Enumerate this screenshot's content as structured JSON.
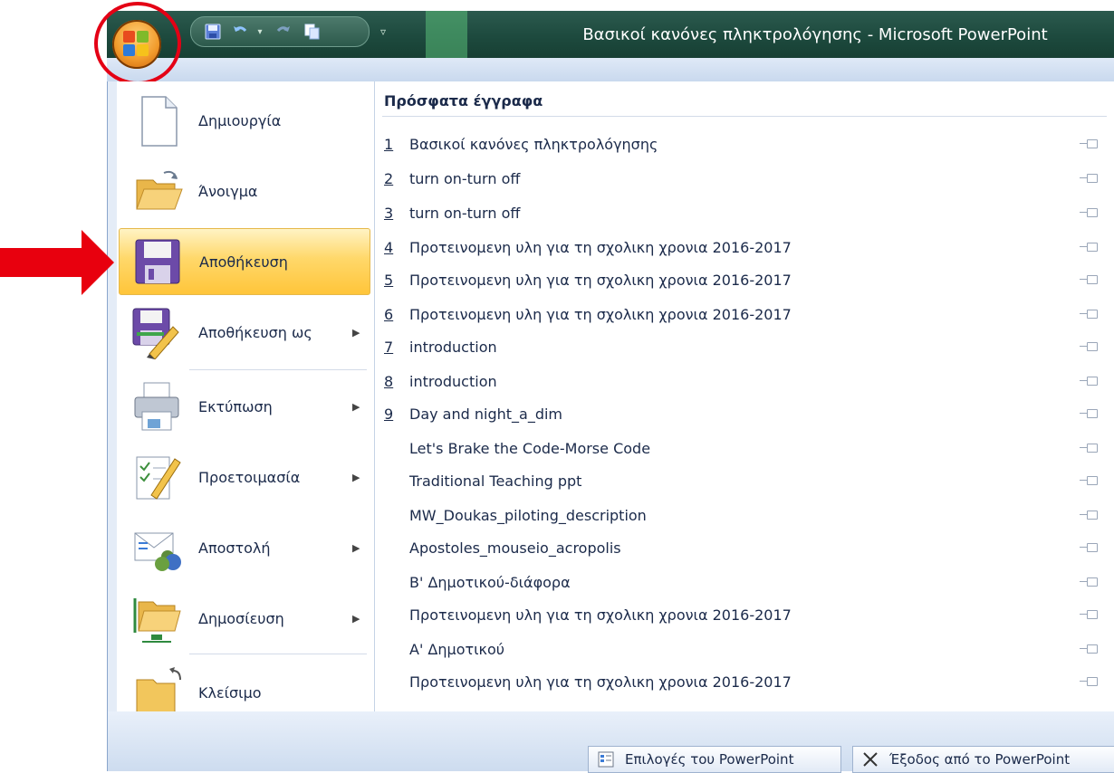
{
  "window": {
    "title": "Βασικοί κανόνες πληκτρολόγησης - Microsoft PowerPoint"
  },
  "quick_access": [
    {
      "icon": "save-icon"
    },
    {
      "icon": "undo-icon"
    },
    {
      "icon": "redo-icon"
    },
    {
      "icon": "new-slide-icon"
    },
    {
      "icon": "customize-dropdown-icon"
    }
  ],
  "menu": {
    "items": [
      {
        "label": "Δημιουργία",
        "icon": "new-document-icon",
        "submenu": false,
        "active": false
      },
      {
        "label": "Άνοιγμα",
        "icon": "open-folder-icon",
        "submenu": false,
        "active": false
      },
      {
        "label": "Αποθήκευση",
        "icon": "save-disk-icon",
        "submenu": false,
        "active": true
      },
      {
        "label": "Αποθήκευση ως",
        "icon": "save-as-icon",
        "submenu": true,
        "active": false
      },
      {
        "label": "Εκτύπωση",
        "icon": "printer-icon",
        "submenu": true,
        "active": false
      },
      {
        "label": "Προετοιμασία",
        "icon": "prepare-icon",
        "submenu": true,
        "active": false
      },
      {
        "label": "Αποστολή",
        "icon": "send-icon",
        "submenu": true,
        "active": false
      },
      {
        "label": "Δημοσίευση",
        "icon": "publish-icon",
        "submenu": true,
        "active": false
      },
      {
        "label": "Κλείσιμο",
        "icon": "close-folder-icon",
        "submenu": false,
        "active": false
      }
    ]
  },
  "recent": {
    "header": "Πρόσφατα έγγραφα",
    "items": [
      {
        "num": "1",
        "name": "Βασικοί κανόνες πληκτρολόγησης"
      },
      {
        "num": "2",
        "name": "turn on-turn off"
      },
      {
        "num": "3",
        "name": "turn on-turn off"
      },
      {
        "num": "4",
        "name": "Προτεινομενη υλη για τη σχολικη χρονια 2016-2017"
      },
      {
        "num": "5",
        "name": "Προτεινομενη υλη για τη σχολικη χρονια 2016-2017"
      },
      {
        "num": "6",
        "name": "Προτεινομενη υλη για τη σχολικη χρονια 2016-2017"
      },
      {
        "num": "7",
        "name": "introduction"
      },
      {
        "num": "8",
        "name": "introduction"
      },
      {
        "num": "9",
        "name": "Day and night_a_dim"
      },
      {
        "num": "",
        "name": "Let's Brake the Code-Morse Code"
      },
      {
        "num": "",
        "name": "Traditional Teaching ppt"
      },
      {
        "num": "",
        "name": "MW_Doukas_piloting_description"
      },
      {
        "num": "",
        "name": "Apostoles_mouseio_acropolis"
      },
      {
        "num": "",
        "name": "Β' Δημοτικού-διάφορα"
      },
      {
        "num": "",
        "name": "Προτεινομενη υλη για τη σχολικη χρονια 2016-2017"
      },
      {
        "num": "",
        "name": "Α' Δημοτικού"
      },
      {
        "num": "",
        "name": "Προτεινομενη υλη για τη σχολικη χρονια 2016-2017"
      }
    ]
  },
  "footer": {
    "options_label": "Επιλογές του PowerPoint",
    "exit_label": "Έξοδος από το PowerPoint"
  },
  "annotations": {
    "arrow_color": "#e8000e",
    "circle_color": "#e40015"
  }
}
